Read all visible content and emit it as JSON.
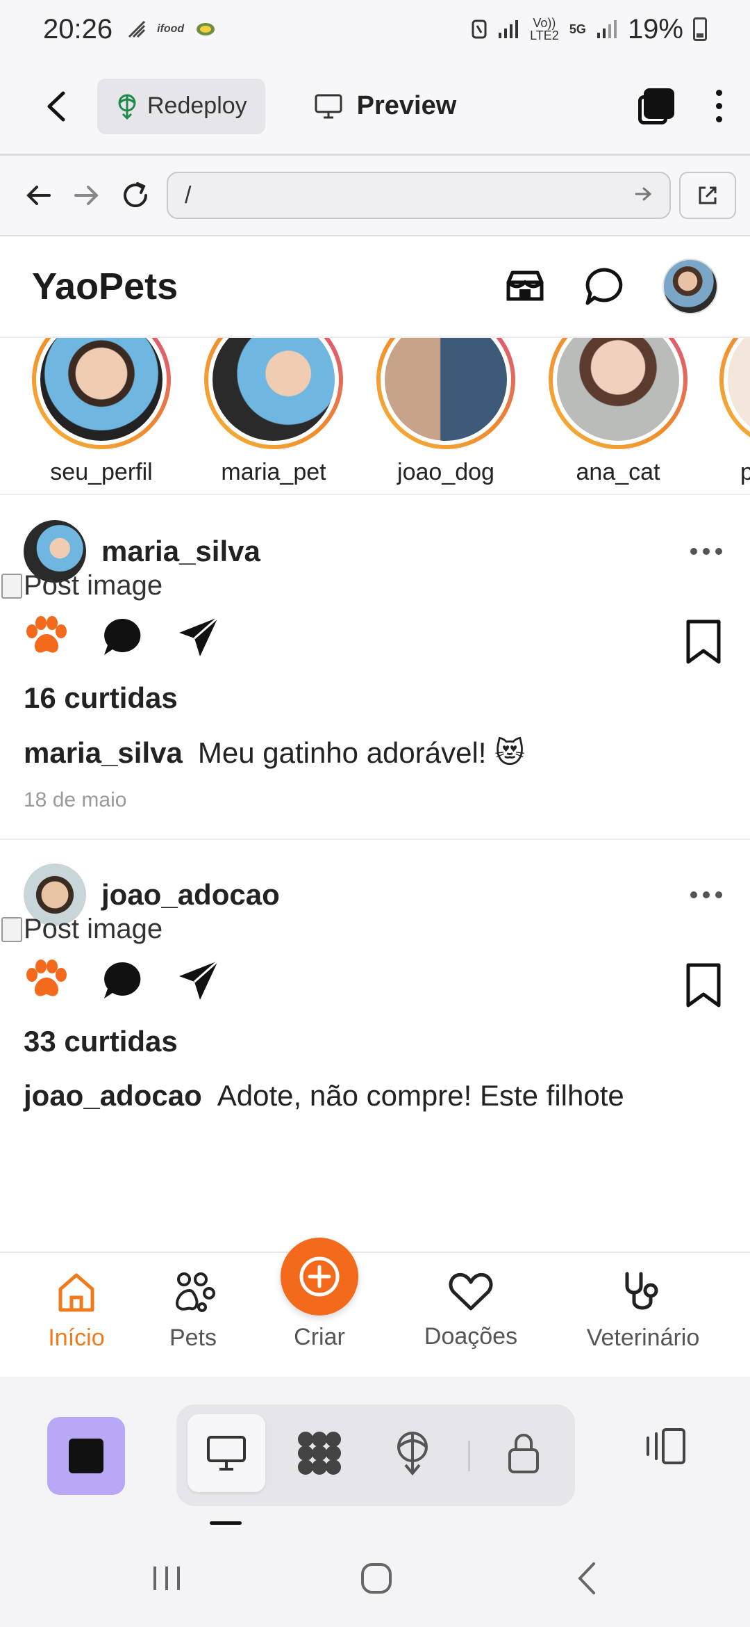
{
  "status_bar": {
    "time": "20:26",
    "left_icons": [
      "signal-wave-icon",
      "ifood-icon",
      "app-badge-icon"
    ],
    "volte_label": "Vo)) LTE2",
    "network": "5G",
    "battery": "19%"
  },
  "app_bar": {
    "redeploy_label": "Redeploy",
    "preview_label": "Preview"
  },
  "browser": {
    "url": "/"
  },
  "site": {
    "brand": "YaoPets",
    "stories": [
      {
        "label": "seu_perfil"
      },
      {
        "label": "maria_pet"
      },
      {
        "label": "joao_dog"
      },
      {
        "label": "ana_cat"
      },
      {
        "label": "p"
      }
    ],
    "posts": [
      {
        "user": "maria_silva",
        "image_alt": "Post image",
        "likes": "16 curtidas",
        "caption_user": "maria_silva",
        "caption_text": "Meu gatinho adorável! 😻",
        "date": "18 de maio"
      },
      {
        "user": "joao_adocao",
        "image_alt": "Post image",
        "likes": "33 curtidas",
        "caption_user": "joao_adocao",
        "caption_text": "Adote, não compre! Este filhote"
      }
    ]
  },
  "bottom_nav": {
    "items": [
      {
        "label": "Início",
        "icon": "home-icon",
        "active": true
      },
      {
        "label": "Pets",
        "icon": "paw-outline-icon"
      },
      {
        "label": "Criar",
        "icon": "plus-circle-icon"
      },
      {
        "label": "Doações",
        "icon": "heart-icon"
      },
      {
        "label": "Veterinário",
        "icon": "stethoscope-icon"
      }
    ]
  },
  "colors": {
    "accent": "#f36a1c",
    "active_nav": "#f07b1d",
    "stop_button": "#b9a8f6"
  }
}
